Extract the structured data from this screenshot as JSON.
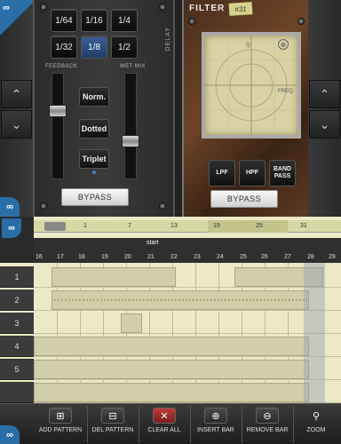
{
  "delay": {
    "label": "DELAY",
    "note_buttons": [
      "1/64",
      "1/16",
      "1/4",
      "1/32",
      "1/8",
      "1/2"
    ],
    "active_note": "1/8",
    "feedback_label": "FEEDBACK",
    "wetmix_label": "WET MIX",
    "modes": [
      "Norm.",
      "Dotted",
      "Triplet"
    ],
    "bypass_label": "BYPASS"
  },
  "filter": {
    "title": "FILTER",
    "tag": "#31",
    "pad_labels": {
      "q": "Q.",
      "freq": "FREQ."
    },
    "types": [
      "LPF",
      "HPF",
      "BAND PASS"
    ],
    "bypass_label": "BYPASS"
  },
  "sequencer": {
    "bar_numbers": [
      "1",
      "7",
      "13",
      "19",
      "25",
      "31"
    ],
    "start_label": "start",
    "step_numbers": [
      "16",
      "17",
      "18",
      "19",
      "20",
      "21",
      "22",
      "23",
      "24",
      "25",
      "26",
      "27",
      "28",
      "29"
    ],
    "tracks": [
      "1",
      "2",
      "3",
      "4",
      "5"
    ]
  },
  "toolbar": {
    "items": [
      {
        "label": "ADD PATTERN",
        "icon": "add-pattern-icon"
      },
      {
        "label": "DEL PATTERN",
        "icon": "delete-pattern-icon"
      },
      {
        "label": "CLEAR ALL",
        "icon": "clear-all-icon"
      },
      {
        "label": "INSERT BAR",
        "icon": "insert-bar-icon"
      },
      {
        "label": "REMOVE BAR",
        "icon": "remove-bar-icon"
      },
      {
        "label": "ZOOM",
        "icon": "zoom-icon"
      }
    ]
  },
  "colors": {
    "accent": "#2a6ea8",
    "active_button": "#3c5f96",
    "sequencer_bg": "#ece9c6"
  }
}
